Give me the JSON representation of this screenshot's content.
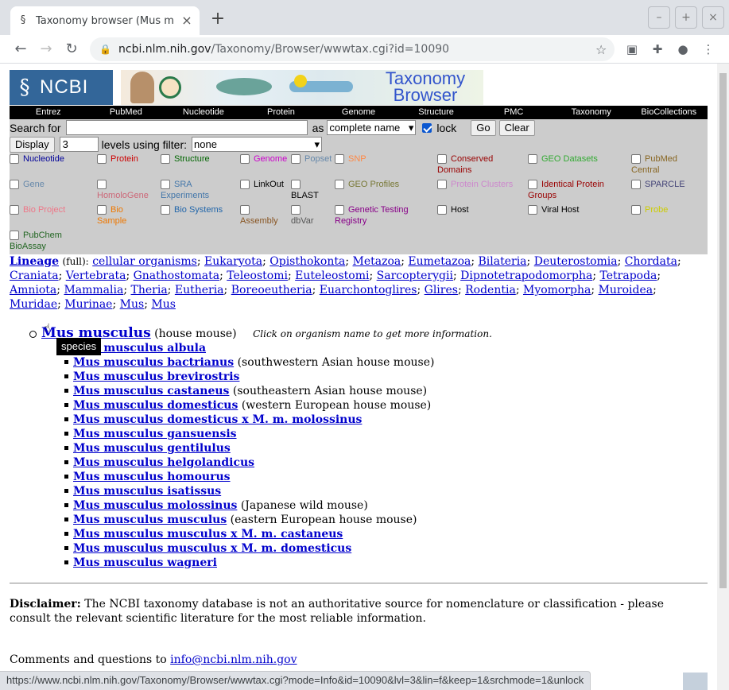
{
  "browser": {
    "tab_title": "Taxonomy browser (Mus m",
    "url_domain": "ncbi.nlm.nih.gov",
    "url_path": "/Taxonomy/Browser/wwwtax.cgi?id=10090",
    "status_url": "https://www.ncbi.nlm.nih.gov/Taxonomy/Browser/wwwtax.cgi?mode=Info&id=10090&lvl=3&lin=f&keep=1&srchmode=1&unlock"
  },
  "banner": {
    "logo_text": "NCBI",
    "browser_title_1": "Taxonomy",
    "browser_title_2": "Browser"
  },
  "navbar": [
    "Entrez",
    "PubMed",
    "Nucleotide",
    "Protein",
    "Genome",
    "Structure",
    "PMC",
    "Taxonomy",
    "BioCollections"
  ],
  "search": {
    "label": "Search for",
    "value": "",
    "as_label": "as",
    "mode_value": "complete name",
    "lock_label": "lock",
    "go_label": "Go",
    "clear_label": "Clear"
  },
  "display": {
    "button_label": "Display",
    "levels_value": "3",
    "levels_label": "levels using filter:",
    "filter_value": "none"
  },
  "filters": [
    {
      "line1": "Nucleotide",
      "line2": "",
      "color": "#000099"
    },
    {
      "line1": "Protein",
      "line2": "",
      "color": "#cc0000"
    },
    {
      "line1": "Structure",
      "line2": "",
      "color": "#006600"
    },
    {
      "line1": "Genome",
      "line2": "",
      "color": "#cc00cc"
    },
    {
      "line1": "Popset",
      "line2": "",
      "color": "#6688aa"
    },
    {
      "line1": "SNP",
      "line2": "",
      "color": "#ff8844"
    },
    {
      "line1": "Conserved",
      "line2": "Domains",
      "color": "#990000"
    },
    {
      "line1": "GEO Datasets",
      "line2": "",
      "color": "#33aa33"
    },
    {
      "line1": "PubMed",
      "line2": "Central",
      "color": "#886622"
    },
    {
      "line1": "Gene",
      "line2": "",
      "color": "#6688aa"
    },
    {
      "line1": "",
      "line2": "HomoloGene",
      "color": "#cc6677"
    },
    {
      "line1": "SRA",
      "line2": "Experiments",
      "color": "#4477aa"
    },
    {
      "line1": "LinkOut",
      "line2": "",
      "color": "#000000"
    },
    {
      "line1": "",
      "line2": "BLAST",
      "color": "#000000"
    },
    {
      "line1": "GEO Profiles",
      "line2": "",
      "color": "#777733"
    },
    {
      "line1": "Protein Clusters",
      "line2": "",
      "color": "#cc88cc"
    },
    {
      "line1": "Identical Protein",
      "line2": "Groups",
      "color": "#990000"
    },
    {
      "line1": "SPARCLE",
      "line2": "",
      "color": "#444477"
    },
    {
      "line1": "Bio Project",
      "line2": "",
      "color": "#ee7788"
    },
    {
      "line1": "Bio",
      "line2": "Sample",
      "color": "#ee7700"
    },
    {
      "line1": "Bio Systems",
      "line2": "",
      "color": "#2266aa"
    },
    {
      "line1": "",
      "line2": "Assembly",
      "color": "#885522"
    },
    {
      "line1": "",
      "line2": "dbVar",
      "color": "#555555"
    },
    {
      "line1": "Genetic Testing",
      "line2": "Registry",
      "color": "#880088"
    },
    {
      "line1": "Host",
      "line2": "",
      "color": "#000000"
    },
    {
      "line1": "Viral Host",
      "line2": "",
      "color": "#000000"
    },
    {
      "line1": "Probe",
      "line2": "",
      "color": "#cccc00"
    },
    {
      "line1": "PubChem",
      "line2": "BioAssay",
      "color": "#226622"
    }
  ],
  "lineage": {
    "label": "Lineage",
    "qualifier": "(full):",
    "items": [
      "cellular organisms",
      "Eukaryota",
      "Opisthokonta",
      "Metazoa",
      "Eumetazoa",
      "Bilateria",
      "Deuterostomia",
      "Chordata",
      "Craniata",
      "Vertebrata",
      "Gnathostomata",
      "Teleostomi",
      "Euteleostomi",
      "Sarcopterygii",
      "Dipnotetrapodomorpha",
      "Tetrapoda",
      "Amniota",
      "Mammalia",
      "Theria",
      "Eutheria",
      "Boreoeutheria",
      "Euarchontoglires",
      "Glires",
      "Rodentia",
      "Myomorpha",
      "Muroidea",
      "Muridae",
      "Murinae",
      "Mus",
      "Mus"
    ]
  },
  "tree": {
    "root_name": "Mus musculus",
    "root_common": "(house mouse)",
    "hint": "Click on organism name to get more information.",
    "tooltip": "species",
    "children": [
      {
        "name": "Mus musculus albula",
        "common": ""
      },
      {
        "name": "Mus musculus bactrianus",
        "common": "(southwestern Asian house mouse)"
      },
      {
        "name": "Mus musculus brevirostris",
        "common": ""
      },
      {
        "name": "Mus musculus castaneus",
        "common": "(southeastern Asian house mouse)"
      },
      {
        "name": "Mus musculus domesticus",
        "common": "(western European house mouse)"
      },
      {
        "name": "Mus musculus domesticus x M. m. molossinus",
        "common": ""
      },
      {
        "name": "Mus musculus gansuensis",
        "common": ""
      },
      {
        "name": "Mus musculus gentilulus",
        "common": ""
      },
      {
        "name": "Mus musculus helgolandicus",
        "common": ""
      },
      {
        "name": "Mus musculus homourus",
        "common": ""
      },
      {
        "name": "Mus musculus isatissus",
        "common": ""
      },
      {
        "name": "Mus musculus molossinus",
        "common": "(Japanese wild mouse)"
      },
      {
        "name": "Mus musculus musculus",
        "common": "(eastern European house mouse)"
      },
      {
        "name": "Mus musculus musculus x M. m. castaneus",
        "common": ""
      },
      {
        "name": "Mus musculus musculus x M. m. domesticus",
        "common": ""
      },
      {
        "name": "Mus musculus wagneri",
        "common": ""
      }
    ]
  },
  "disclaimer": {
    "label": "Disclaimer:",
    "text": "The NCBI taxonomy database is not an authoritative source for nomenclature or classification - please consult the relevant scientific literature for the most reliable information."
  },
  "contact": {
    "text": "Comments and questions to",
    "email": "info@ncbi.nlm.nih.gov"
  }
}
